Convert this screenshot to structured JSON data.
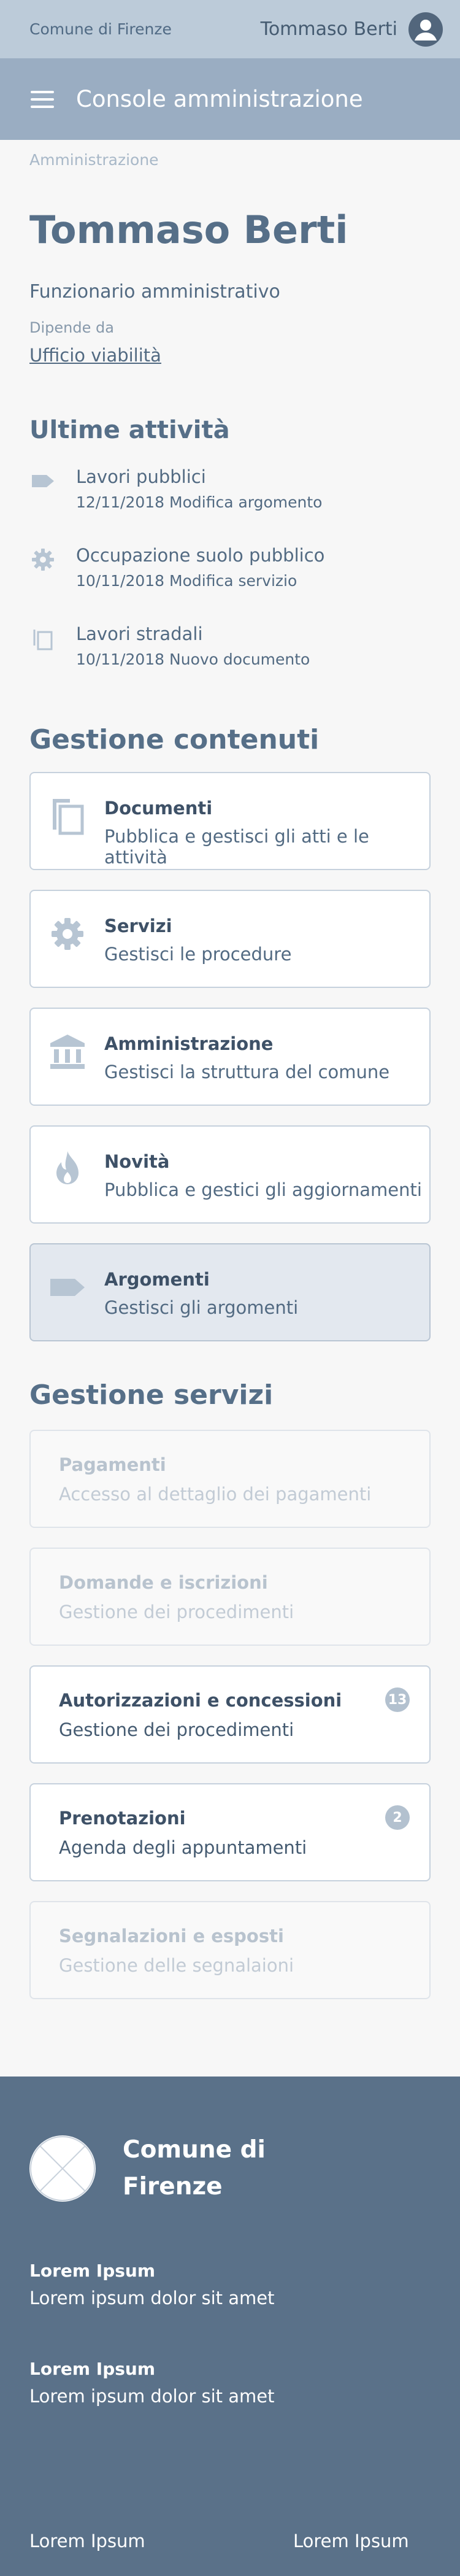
{
  "topbar": {
    "city": "Comune di Firenze",
    "user_name": "Tommaso Berti"
  },
  "header": {
    "title": "Console amministrazione"
  },
  "breadcrumb": "Amministrazione",
  "profile": {
    "name": "Tommaso Berti",
    "role": "Funzionario amministrativo",
    "depends_label": "Dipende da",
    "depends_link": "Ufficio viabilità"
  },
  "activities": {
    "title": "Ultime attività",
    "items": [
      {
        "icon": "tag-icon",
        "title": "Lavori pubblici",
        "detail": "12/11/2018 Modifica argomento"
      },
      {
        "icon": "gear-icon",
        "title": "Occupazione suolo pubblico",
        "detail": "10/11/2018 Modifica servizio"
      },
      {
        "icon": "copy-icon",
        "title": "Lavori stradali",
        "detail": "10/11/2018 Nuovo documento"
      }
    ]
  },
  "content_management": {
    "title": "Gestione contenuti",
    "cards": [
      {
        "icon": "documents-icon",
        "title": "Documenti",
        "subtitle": "Pubblica e gestisci gli atti e le attività"
      },
      {
        "icon": "gear-icon",
        "title": "Servizi",
        "subtitle": "Gestisci le procedure"
      },
      {
        "icon": "institution-icon",
        "title": "Amministrazione",
        "subtitle": "Gestisci la struttura del comune"
      },
      {
        "icon": "flame-icon",
        "title": "Novità",
        "subtitle": "Pubblica e gestici gli aggiornamenti"
      },
      {
        "icon": "tag-icon",
        "title": "Argomenti",
        "subtitle": "Gestisci gli argomenti"
      }
    ]
  },
  "service_management": {
    "title": "Gestione servizi",
    "cards": [
      {
        "title": "Pagamenti",
        "subtitle": "Accesso al dettaglio dei pagamenti"
      },
      {
        "title": "Domande e iscrizioni",
        "subtitle": "Gestione dei procedimenti"
      },
      {
        "title": "Autorizzazioni e concessioni",
        "subtitle": "Gestione dei procedimenti",
        "badge": "13"
      },
      {
        "title": "Prenotazioni",
        "subtitle": "Agenda degli appuntamenti",
        "badge": "2"
      },
      {
        "title": "Segnalazioni e esposti",
        "subtitle": "Gestione delle segnalaioni"
      }
    ]
  },
  "footer": {
    "name": "Comune di Firenze",
    "blocks": [
      {
        "heading": "Lorem Ipsum",
        "text": "Lorem ipsum dolor sit amet"
      },
      {
        "heading": "Lorem Ipsum",
        "text": "Lorem ipsum dolor sit amet"
      }
    ],
    "links": [
      "Lorem Ipsum",
      "Lorem Ipsum"
    ]
  }
}
